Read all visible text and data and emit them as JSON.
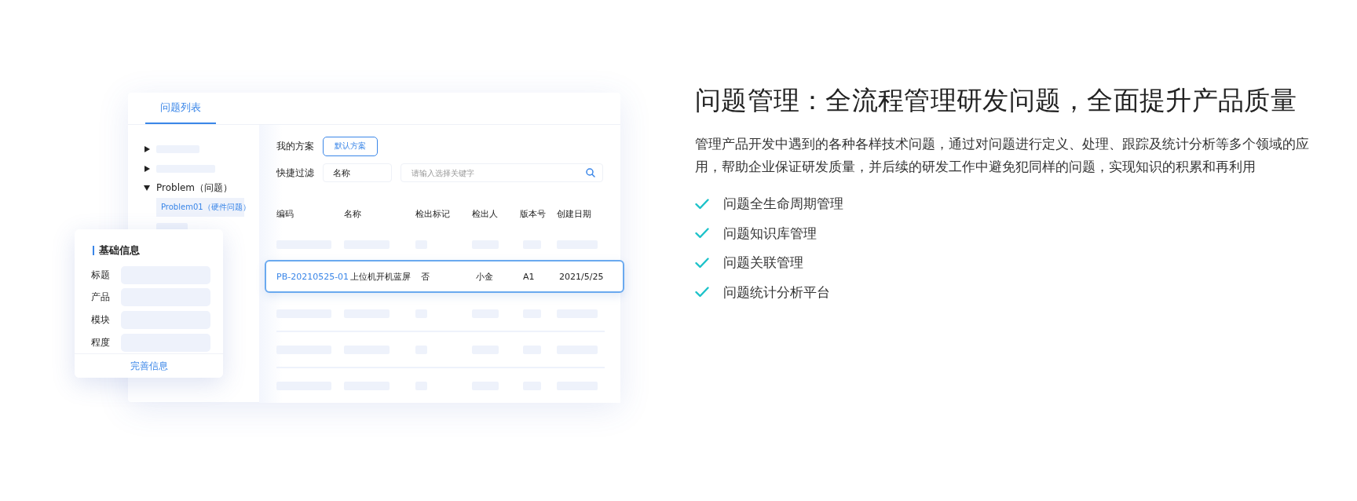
{
  "tabs": [
    {
      "label": "问题列表",
      "selected": true
    }
  ],
  "tree": [
    {
      "kind": "placeholder",
      "expanded": false
    },
    {
      "kind": "placeholder",
      "expanded": false
    },
    {
      "kind": "node",
      "label": "Problem（问题）",
      "expanded": true,
      "children": [
        {
          "kind": "node",
          "label": "Problem01（硬件问题）",
          "selected": true
        },
        {
          "kind": "placeholder",
          "selected": false
        }
      ]
    }
  ],
  "filters": {
    "scheme_label": "我的方案",
    "scheme_button": "默认方案",
    "filter_label": "快捷过滤",
    "filter_select": "名称",
    "search": {
      "placeholder": "请输入选择关键字"
    }
  },
  "table": {
    "columns": [
      "编码",
      "名称",
      "检出标记",
      "检出人",
      "版本号",
      "创建日期"
    ],
    "rows": [
      {
        "kind": "placeholder",
        "selected": false
      },
      {
        "kind": "data",
        "selected": true,
        "cells": [
          "PB-20210525-01",
          "上位机开机蓝屏",
          "否",
          "小金",
          "A1",
          "2021/5/25"
        ]
      },
      {
        "kind": "placeholder",
        "selected": false
      },
      {
        "kind": "placeholder",
        "selected": false
      },
      {
        "kind": "placeholder",
        "selected": false
      }
    ]
  },
  "form_card": {
    "title": "基础信息",
    "fields": [
      "标题",
      "产品",
      "模块",
      "程度"
    ],
    "footer_button": "完善信息"
  },
  "intro": {
    "headline": "问题管理：全流程管理研发问题，全面提升产品质量",
    "description": "管理产品开发中遇到的各种各样技术问题，通过对问题进行定义、处理、跟踪及统计分析等多个领域的应用，帮助企业保证研发质量，并后续的研发工作中避免犯同样的问题，实现知识的积累和再利用",
    "features": [
      "问题全生命周期管理",
      "问题知识库管理",
      "问题关联管理",
      "问题统计分析平台"
    ]
  }
}
